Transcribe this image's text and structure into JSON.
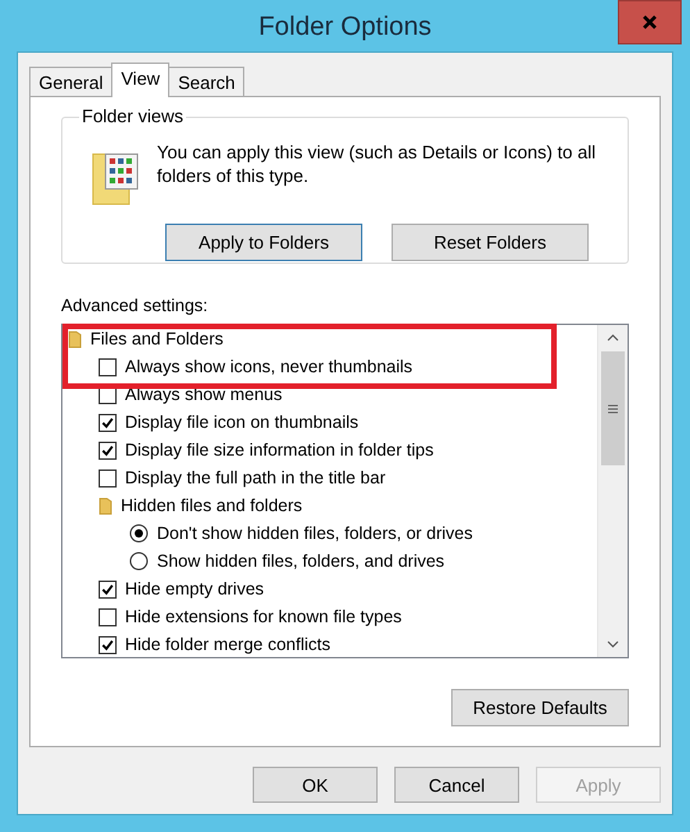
{
  "window": {
    "title": "Folder Options"
  },
  "tabs": [
    {
      "label": "General",
      "selected": false
    },
    {
      "label": "View",
      "selected": true
    },
    {
      "label": "Search",
      "selected": false
    }
  ],
  "folder_views": {
    "title": "Folder views",
    "description": "You can apply this view (such as Details or Icons) to all folders of this type.",
    "buttons": [
      "Apply to Folders",
      "Reset Folders"
    ]
  },
  "advanced": {
    "label": "Advanced settings:",
    "annotation": {
      "kind": "red-box"
    },
    "items": [
      {
        "kind": "folder",
        "label": "Files and Folders",
        "children": [
          {
            "kind": "checkbox",
            "label": "Always show icons, never thumbnails",
            "checked": false
          },
          {
            "kind": "checkbox",
            "label": "Always show menus",
            "checked": false
          },
          {
            "kind": "checkbox",
            "label": "Display file icon on thumbnails",
            "checked": true
          },
          {
            "kind": "checkbox",
            "label": "Display file size information in folder tips",
            "checked": true
          },
          {
            "kind": "checkbox",
            "label": "Display the full path in the title bar",
            "checked": false
          },
          {
            "kind": "folder",
            "label": "Hidden files and folders",
            "children": [
              {
                "kind": "radio",
                "label": "Don't show hidden files, folders, or drives",
                "selected": true
              },
              {
                "kind": "radio",
                "label": "Show hidden files, folders, and drives",
                "selected": false
              }
            ]
          },
          {
            "kind": "checkbox",
            "label": "Hide empty drives",
            "checked": true
          },
          {
            "kind": "checkbox",
            "label": "Hide extensions for known file types",
            "checked": false
          },
          {
            "kind": "checkbox",
            "label": "Hide folder merge conflicts",
            "checked": true
          }
        ]
      }
    ]
  },
  "restore_button": "Restore Defaults",
  "footer_buttons": [
    {
      "label": "OK",
      "disabled": false
    },
    {
      "label": "Cancel",
      "disabled": false
    },
    {
      "label": "Apply",
      "disabled": true
    }
  ]
}
